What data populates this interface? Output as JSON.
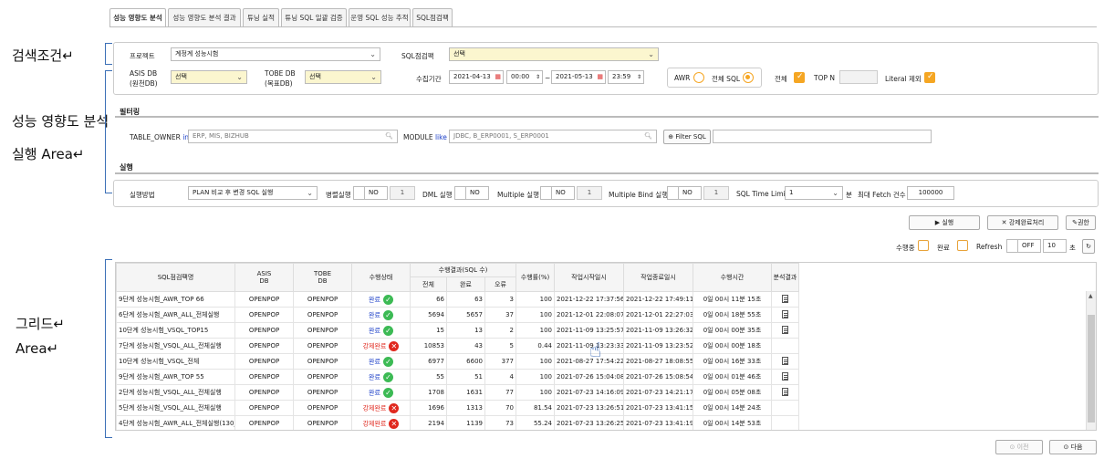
{
  "notes": {
    "search": "검색조건↵",
    "analysis1": "성능 영향도 분석",
    "analysis2": "실행 Area↵",
    "grid1": "그리드↵",
    "grid2": "Area↵"
  },
  "tabs": [
    "성능 영향도 분석",
    "성능 영향도 분석 결과",
    "튜닝 실적",
    "튜닝 SQL 일괄 검증",
    "운영 SQL 성능 추적",
    "SQL점검팩"
  ],
  "search": {
    "project_label": "프로젝트",
    "project_value": "계정계 성능시험",
    "sqlpack_label": "SQL점검팩",
    "sqlpack_value": "선택",
    "asis_label1": "ASIS DB",
    "asis_label2": "(원천DB)",
    "asis_value": "선택",
    "tobe_label1": "TOBE DB",
    "tobe_label2": "(목표DB)",
    "tobe_value": "선택",
    "period_label": "수집기간",
    "date_from": "2021-04-13",
    "time_from": "00:00",
    "tilde": "~",
    "date_to": "2021-05-13",
    "time_to": "23:59",
    "awr_label": "AWR",
    "all_sql_label": "전체 SQL",
    "all_label": "전체",
    "topn_label": "TOP N",
    "literal_label": "Literal 제외"
  },
  "filter": {
    "title": "필터링",
    "owner_label": "TABLE_OWNER",
    "owner_op": "in",
    "owner_placeholder": "ERP, MIS, BIZHUB",
    "module_label": "MODULE",
    "module_op": "like",
    "module_placeholder": "JDBC, B_ERP0001, S_ERP0001",
    "filter_btn": "Filter SQL"
  },
  "exec": {
    "title": "실행",
    "method_label": "실행방법",
    "method_value": "PLAN 비교 후 변경 SQL 실행",
    "parallel_label": "병렬실행",
    "parallel_state": "NO",
    "parallel_num": "1",
    "dml_label": "DML 실행",
    "dml_state": "NO",
    "multiple_label": "Multiple 실행",
    "multiple_state": "NO",
    "multiple_num": "1",
    "mbind_label": "Multiple Bind 실행",
    "mbind_state": "NO",
    "mbind_num": "1",
    "timelimit_label": "SQL Time Limit",
    "timelimit_value": "1",
    "min_label": "분",
    "fetch_label": "최대 Fetch 건수",
    "fetch_value": "100000"
  },
  "actions": {
    "run": "실행",
    "force_complete": "강제완료처리",
    "permission": "권한"
  },
  "status_bar": {
    "running": "수행중",
    "done": "완료",
    "refresh": "Refresh",
    "toggle": "OFF",
    "interval": "10",
    "sec": "초"
  },
  "grid": {
    "headers": {
      "name": "SQL점검팩명",
      "asis1": "ASIS",
      "asis2": "DB",
      "tobe1": "TOBE",
      "tobe2": "DB",
      "state": "수행상태",
      "result": "수행결과(SQL 수)",
      "total": "전체",
      "done": "완료",
      "error": "오류",
      "rate": "수행률(%)",
      "start": "작업시작일시",
      "end": "작업종료일시",
      "time": "수행시간",
      "analysis": "분석결과"
    },
    "rows": [
      {
        "name": "9단계 성능시험_AWR_TOP 66",
        "asis": "OPENPOP",
        "tobe": "OPENPOP",
        "state": "완료",
        "ok": true,
        "total": "66",
        "done": "63",
        "error": "3",
        "rate": "100",
        "start": "2021-12-22 17:37:56",
        "end": "2021-12-22 17:49:11",
        "time": "0일 00시 11분 15초",
        "doc": true
      },
      {
        "name": "6단계 성능시험_AWR_ALL_전체실행",
        "asis": "OPENPOP",
        "tobe": "OPENPOP",
        "state": "완료",
        "ok": true,
        "total": "5694",
        "done": "5657",
        "error": "37",
        "rate": "100",
        "start": "2021-12-01 22:08:07",
        "end": "2021-12-01 22:27:03",
        "time": "0일 00시 18분 55초",
        "doc": true
      },
      {
        "name": "10단계 성능시험_VSQL_TOP15",
        "asis": "OPENPOP",
        "tobe": "OPENPOP",
        "state": "완료",
        "ok": true,
        "total": "15",
        "done": "13",
        "error": "2",
        "rate": "100",
        "start": "2021-11-09 13:25:57",
        "end": "2021-11-09 13:26:32",
        "time": "0일 00시 00분 35초",
        "doc": true
      },
      {
        "name": "7단계 성능시험_VSQL_ALL_전체실행",
        "asis": "OPENPOP",
        "tobe": "OPENPOP",
        "state": "강제완료",
        "ok": false,
        "total": "10853",
        "done": "43",
        "error": "5",
        "rate": "0.44",
        "start": "2021-11-09 13:23:33",
        "end": "2021-11-09 13:23:52",
        "time": "0일 00시 00분 18초",
        "doc": false
      },
      {
        "name": "10단계 성능시험_VSQL_전체",
        "asis": "OPENPOP",
        "tobe": "OPENPOP",
        "state": "완료",
        "ok": true,
        "total": "6977",
        "done": "6600",
        "error": "377",
        "rate": "100",
        "start": "2021-08-27 17:54:22",
        "end": "2021-08-27 18:08:55",
        "time": "0일 00시 16분 33초",
        "doc": true
      },
      {
        "name": "9단계 성능시험_AWR_TOP 55",
        "asis": "OPENPOP",
        "tobe": "OPENPOP",
        "state": "완료",
        "ok": true,
        "total": "55",
        "done": "51",
        "error": "4",
        "rate": "100",
        "start": "2021-07-26 15:04:08",
        "end": "2021-07-26 15:08:54",
        "time": "0일 00시 01분 46초",
        "doc": true
      },
      {
        "name": "2단계 성능시험_VSQL_ALL_전체실행",
        "asis": "OPENPOP",
        "tobe": "OPENPOP",
        "state": "완료",
        "ok": true,
        "total": "1708",
        "done": "1631",
        "error": "77",
        "rate": "100",
        "start": "2021-07-23 14:16:09",
        "end": "2021-07-23 14:21:17",
        "time": "0일 00시 05분 08초",
        "doc": true
      },
      {
        "name": "5단계 성능시험_VSQL_ALL_전체실행",
        "asis": "OPENPOP",
        "tobe": "OPENPOP",
        "state": "강제완료",
        "ok": false,
        "total": "1696",
        "done": "1313",
        "error": "70",
        "rate": "81.54",
        "start": "2021-07-23 13:26:51",
        "end": "2021-07-23 13:41:15",
        "time": "0일 00시 14분 24초",
        "doc": false
      },
      {
        "name": "4단계 성능시험_AWR_ALL_전체실행(130_",
        "asis": "OPENPOP",
        "tobe": "OPENPOP",
        "state": "강제완료",
        "ok": false,
        "total": "2194",
        "done": "1139",
        "error": "73",
        "rate": "55.24",
        "start": "2021-07-23 13:26:25",
        "end": "2021-07-23 13:41:19",
        "time": "0일 00시 14분 53초",
        "doc": false
      }
    ]
  },
  "pager": {
    "prev": "이전",
    "next": "다음"
  }
}
